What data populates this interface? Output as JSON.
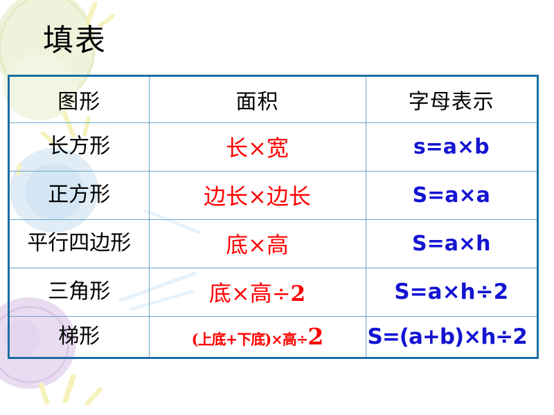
{
  "slide": {
    "title": "填表",
    "background_color": "#ffffff",
    "accent_colors": {
      "table_outer_border": "#1b6da4",
      "table_inner_border": "#6ba3c8",
      "formula_red": "#ff0000",
      "formula_blue": "#1414d2",
      "text_black": "#000000",
      "deco_green": "#eef4dc",
      "deco_blue": "#dceaf5",
      "deco_purple": "#eadcf0",
      "deco_yellow": "#f6f2bd"
    }
  },
  "table": {
    "headers": [
      "图形",
      "面积",
      "字母表示"
    ],
    "rows": [
      {
        "shape": "长方形",
        "area": "长×宽",
        "letter": "s=a×b"
      },
      {
        "shape": "正方形",
        "area": "边长×边长",
        "letter": "S=a×a"
      },
      {
        "shape": "平行四边形",
        "area": "底×高",
        "letter": "S=a×h"
      },
      {
        "shape": "三角形",
        "area_main": "底×高÷",
        "area_tail": "2",
        "area": "底×高÷2",
        "letter": "S=a×h÷2"
      },
      {
        "shape": "梯形",
        "area_main": "(上底+下底)×高÷",
        "area_tail": "2",
        "area": "(上底+下底)×高÷2",
        "letter": "S=(a+b)×h÷2"
      }
    ]
  }
}
